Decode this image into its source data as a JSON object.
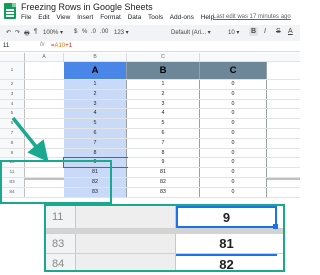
{
  "app": {
    "title": "Freezing Rows in Google Sheets",
    "menu": [
      "File",
      "Edit",
      "View",
      "Insert",
      "Format",
      "Data",
      "Tools",
      "Add-ons",
      "Help"
    ],
    "last_edit": "Last edit was 17 minutes ago"
  },
  "toolbar": {
    "items": [
      "↶",
      "↷",
      "🖶",
      "¶",
      "100% ▾",
      "$",
      "%",
      ".0",
      ".00",
      "123 ▾",
      "Default (Ari... ▾",
      "10 ▾",
      "B",
      "I",
      "S",
      "A"
    ]
  },
  "formula_bar": {
    "cell": "11",
    "fx": "fx",
    "formula_prefix": "=",
    "formula_ref": "A10",
    "formula_suffix": "+1"
  },
  "columns": [
    "A",
    "B",
    "C"
  ],
  "row_numbers": [
    "1",
    "2",
    "3",
    "4",
    "5",
    "6",
    "7",
    "8",
    "9",
    "10",
    "11",
    "83",
    "84"
  ],
  "header_row": [
    "A",
    "B",
    "C"
  ],
  "rows": [
    [
      "1",
      "1",
      "0"
    ],
    [
      "2",
      "2",
      "0"
    ],
    [
      "3",
      "3",
      "0"
    ],
    [
      "4",
      "4",
      "0"
    ],
    [
      "5",
      "5",
      "0"
    ],
    [
      "6",
      "6",
      "0"
    ],
    [
      "7",
      "7",
      "0"
    ],
    [
      "8",
      "8",
      "0"
    ],
    [
      "9",
      "9",
      "0"
    ],
    [
      "81",
      "81",
      "0"
    ],
    [
      "82",
      "82",
      "0"
    ],
    [
      "83",
      "83",
      "0"
    ]
  ],
  "zoom": {
    "rows": [
      {
        "num": "11",
        "value": "9"
      },
      {
        "num": "83",
        "value": "81"
      },
      {
        "num": "84",
        "value": "82"
      }
    ]
  },
  "colors": {
    "accent": "#1aa88f",
    "col_a": "#4a86e8",
    "col_bc": "#6d8799",
    "selection": "#1a73e8"
  }
}
